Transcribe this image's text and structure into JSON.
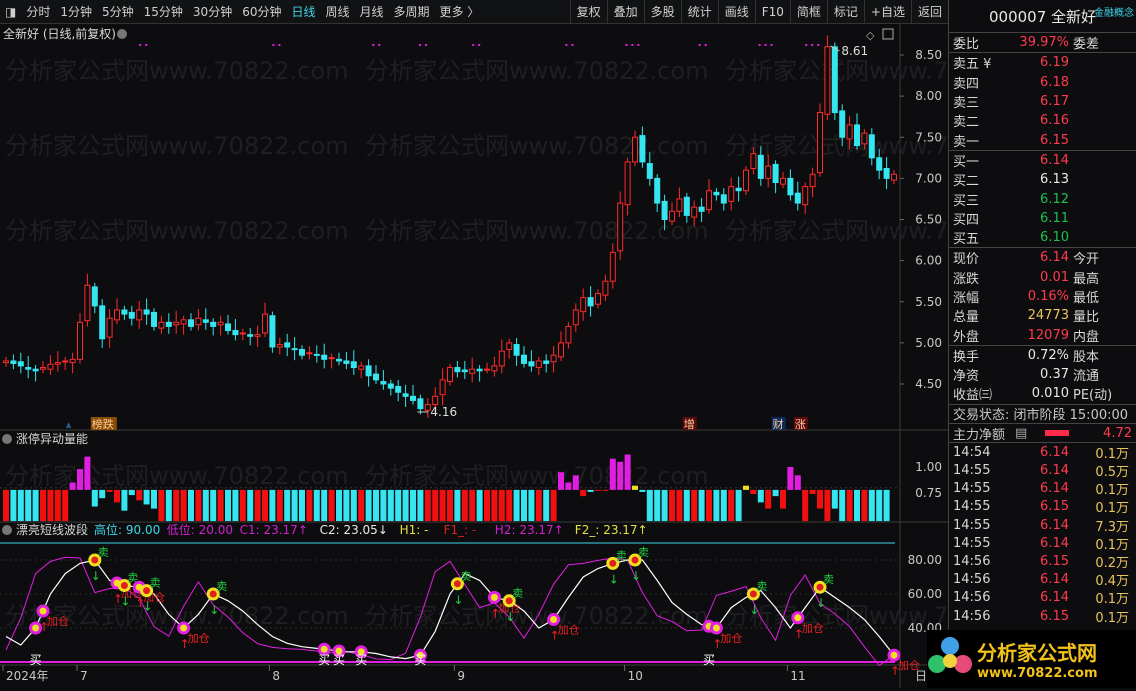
{
  "toolbar": {
    "periods": [
      "分时",
      "1分钟",
      "5分钟",
      "15分钟",
      "30分钟",
      "60分钟",
      "日线",
      "周线",
      "月线",
      "多周期",
      "更多 〉"
    ],
    "active": "日线",
    "actions": [
      "复权",
      "叠加",
      "多股",
      "统计",
      "画线",
      "F10",
      "简框",
      "标记",
      "+自选",
      "返回"
    ]
  },
  "chart": {
    "title": "全新好 (日线,前复权)",
    "price_axis": [
      "8.50",
      "8.00",
      "7.50",
      "7.00",
      "6.50",
      "6.00",
      "5.50",
      "5.00",
      "4.50"
    ],
    "high_label": "8.61",
    "low_label": "4.16",
    "events": [
      {
        "i": 12,
        "text": "榜跌",
        "color": "#8a4a00"
      },
      {
        "i": 92,
        "text": "增",
        "color": "#5a0a0a"
      },
      {
        "i": 104,
        "text": "财",
        "color": "#0a2a5a"
      },
      {
        "i": 107,
        "text": "涨",
        "color": "#5a0a0a"
      }
    ],
    "closes": [
      4.78,
      4.75,
      4.72,
      4.68,
      4.66,
      4.7,
      4.74,
      4.76,
      4.78,
      4.8,
      5.25,
      5.7,
      5.45,
      5.05,
      5.3,
      5.4,
      5.35,
      5.3,
      5.4,
      5.35,
      5.2,
      5.25,
      5.2,
      5.25,
      5.28,
      5.2,
      5.3,
      5.25,
      5.2,
      5.25,
      5.15,
      5.1,
      5.12,
      5.08,
      5.1,
      5.35,
      4.95,
      4.98,
      4.95,
      4.92,
      4.85,
      4.88,
      4.85,
      4.8,
      4.82,
      4.78,
      4.75,
      4.7,
      4.72,
      4.6,
      4.55,
      4.5,
      4.45,
      4.4,
      4.35,
      4.3,
      4.2,
      4.25,
      4.35,
      4.55,
      4.7,
      4.65,
      4.65,
      4.68,
      4.66,
      4.68,
      4.72,
      4.9,
      5.0,
      4.85,
      4.75,
      4.72,
      4.78,
      4.75,
      4.85,
      5.0,
      5.2,
      5.4,
      5.55,
      5.45,
      5.6,
      5.75,
      6.1,
      6.7,
      7.2,
      7.5,
      7.2,
      7.0,
      6.7,
      6.5,
      6.6,
      6.75,
      6.55,
      6.65,
      6.6,
      6.85,
      6.8,
      6.7,
      6.9,
      6.85,
      7.1,
      7.3,
      7.0,
      7.15,
      6.95,
      7.0,
      6.8,
      6.7,
      6.9,
      7.05,
      7.8,
      8.6,
      7.8,
      7.5,
      7.65,
      7.4,
      7.55,
      7.25,
      7.1,
      7.0,
      7.05
    ]
  },
  "volume_indicator": {
    "title": "涨停异动量能",
    "axis": [
      "1.00",
      "0.75"
    ],
    "values": [
      0.48,
      0.48,
      0.48,
      0.48,
      0.48,
      0.48,
      0.48,
      0.48,
      0.48,
      0.85,
      0.98,
      1.1,
      0.62,
      0.7,
      0.76,
      0.66,
      0.58,
      0.73,
      0.68,
      0.64,
      0.6,
      0.48,
      0.48,
      0.48,
      0.48,
      0.48,
      0.48,
      0.48,
      0.48,
      0.48,
      0.48,
      0.48,
      0.48,
      0.48,
      0.48,
      0.48,
      0.48,
      0.48,
      0.48,
      0.48,
      0.48,
      0.48,
      0.48,
      0.48,
      0.48,
      0.48,
      0.48,
      0.48,
      0.48,
      0.48,
      0.48,
      0.48,
      0.48,
      0.48,
      0.48,
      0.48,
      0.48,
      0.48,
      0.48,
      0.48,
      0.48,
      0.48,
      0.48,
      0.48,
      0.48,
      0.48,
      0.48,
      0.48,
      0.48,
      0.48,
      0.48,
      0.48,
      0.48,
      0.48,
      0.48,
      0.95,
      0.85,
      0.92,
      0.72,
      0.76,
      0.8,
      0.78,
      1.08,
      1.05,
      1.12,
      0.82,
      0.76,
      0.48,
      0.48,
      0.48,
      0.48,
      0.48,
      0.48,
      0.48,
      0.48,
      0.48,
      0.48,
      0.48,
      0.48,
      0.48,
      0.82,
      0.74,
      0.66,
      0.6,
      0.72,
      0.6,
      1.0,
      0.92,
      0.48,
      0.74,
      0.6,
      0.48,
      0.6,
      0.48,
      0.48,
      0.48,
      0.48,
      0.48,
      0.48,
      0.48
    ]
  },
  "wave_indicator": {
    "title": "漂亮短线波段",
    "params": [
      {
        "text": "高位: 90.00",
        "color": "#3fd6e8"
      },
      {
        "text": "低位: 20.00",
        "color": "#d21fd2"
      },
      {
        "text": "C1: 23.17↑",
        "color": "#d21fd2"
      },
      {
        "text": "C2: 23.05↓",
        "color": "#e8e8e8"
      },
      {
        "text": "H1: -",
        "color": "#e8e040"
      },
      {
        "text": "F1_: -",
        "color": "#e02020"
      },
      {
        "text": "H2: 23.17↑",
        "color": "#d21fd2"
      },
      {
        "text": "F2_: 23.17↑",
        "color": "#e8e040"
      }
    ],
    "axis": [
      "80.00",
      "60.00",
      "40.00"
    ],
    "high": 90,
    "low": 20,
    "line": [
      35,
      30,
      40,
      60,
      72,
      78,
      80,
      68,
      65,
      64,
      60,
      48,
      40,
      48,
      60,
      56,
      50,
      42,
      35,
      31,
      29,
      28,
      27,
      26,
      26,
      25,
      23,
      22,
      24,
      38,
      60,
      72,
      68,
      58,
      56,
      50,
      40,
      45,
      58,
      70,
      75,
      78,
      80,
      80,
      68,
      55,
      48,
      42,
      40,
      52,
      58,
      62,
      52,
      40,
      52,
      64,
      58,
      52,
      45,
      35,
      24
    ],
    "signals": [
      {
        "i": 4,
        "t": "买"
      },
      {
        "i": 5,
        "t": "加仓"
      },
      {
        "i": 12,
        "t": "卖"
      },
      {
        "i": 15,
        "t": "加仓"
      },
      {
        "i": 16,
        "t": "卖"
      },
      {
        "i": 18,
        "t": "加仓"
      },
      {
        "i": 19,
        "t": "卖"
      },
      {
        "i": 24,
        "t": "加仓"
      },
      {
        "i": 28,
        "t": "卖"
      },
      {
        "i": 43,
        "t": "买"
      },
      {
        "i": 45,
        "t": "买"
      },
      {
        "i": 48,
        "t": "买"
      },
      {
        "i": 56,
        "t": "买"
      },
      {
        "i": 61,
        "t": "卖"
      },
      {
        "i": 66,
        "t": "加仓"
      },
      {
        "i": 68,
        "t": "卖"
      },
      {
        "i": 74,
        "t": "加仓"
      },
      {
        "i": 82,
        "t": "卖"
      },
      {
        "i": 85,
        "t": "卖"
      },
      {
        "i": 95,
        "t": "买"
      },
      {
        "i": 96,
        "t": "加仓"
      },
      {
        "i": 101,
        "t": "卖"
      },
      {
        "i": 107,
        "t": "加仓"
      },
      {
        "i": 110,
        "t": "卖"
      },
      {
        "i": 120,
        "t": "加仓"
      }
    ]
  },
  "time_axis": [
    {
      "x": "2024年",
      "i": 0
    },
    {
      "x": "7",
      "i": 10
    },
    {
      "x": "8",
      "i": 36
    },
    {
      "x": "9",
      "i": 61
    },
    {
      "x": "10",
      "i": 84
    },
    {
      "x": "11",
      "i": 106
    }
  ],
  "time_axis_end": "日",
  "quote": {
    "code_name": "000007 全新好",
    "concept_tag": "金融概念",
    "weibi_label": "委比",
    "weibi": "39.97%",
    "weicha_label": "委差",
    "asks": [
      {
        "l": "卖五 ¥",
        "v": "6.19"
      },
      {
        "l": "卖四",
        "v": "6.18"
      },
      {
        "l": "卖三",
        "v": "6.17"
      },
      {
        "l": "卖二",
        "v": "6.16"
      },
      {
        "l": "卖一",
        "v": "6.15"
      }
    ],
    "bids": [
      {
        "l": "买一",
        "v": "6.14",
        "c": "red"
      },
      {
        "l": "买二",
        "v": "6.13",
        "c": "wht"
      },
      {
        "l": "买三",
        "v": "6.12",
        "c": "grn"
      },
      {
        "l": "买四",
        "v": "6.11",
        "c": "grn"
      },
      {
        "l": "买五",
        "v": "6.10",
        "c": "grn"
      }
    ],
    "stats1": [
      {
        "l": "现价",
        "v": "6.14",
        "c": "red",
        "r": "今开"
      },
      {
        "l": "涨跌",
        "v": "0.01",
        "c": "red",
        "r": "最高"
      },
      {
        "l": "涨幅",
        "v": "0.16%",
        "c": "red",
        "r": "最低"
      },
      {
        "l": "总量",
        "v": "24773",
        "c": "yel",
        "r": "量比"
      },
      {
        "l": "外盘",
        "v": "12079",
        "c": "red",
        "r": "内盘"
      }
    ],
    "stats2": [
      {
        "l": "换手",
        "v": "0.72%",
        "c": "wht",
        "r": "股本"
      },
      {
        "l": "净资",
        "v": "0.37",
        "c": "wht",
        "r": "流通"
      },
      {
        "l": "收益㈢",
        "v": "0.010",
        "c": "wht",
        "r": "PE(动)"
      }
    ],
    "status": "交易状态: 闭市阶段 15:00:00",
    "main_flow_label": "主力净额",
    "main_flow": "4.72",
    "ticks": [
      [
        "14:54",
        "6.14",
        "0.1万"
      ],
      [
        "14:55",
        "6.14",
        "0.5万"
      ],
      [
        "14:55",
        "6.14",
        "0.1万"
      ],
      [
        "14:55",
        "6.15",
        "0.1万"
      ],
      [
        "14:55",
        "6.14",
        "7.3万"
      ],
      [
        "14:55",
        "6.14",
        "0.1万"
      ],
      [
        "14:56",
        "6.15",
        "0.2万"
      ],
      [
        "14:56",
        "6.14",
        "0.4万"
      ],
      [
        "14:56",
        "6.14",
        "0.1万"
      ],
      [
        "14:56",
        "6.15",
        "0.1万"
      ]
    ]
  },
  "watermark": {
    "site_text": "分析家公式网",
    "url": "www.70822.com"
  },
  "colors": {
    "up": "#ff2a2a",
    "down": "#35e6f0",
    "magenta": "#e21ee2",
    "bg": "#0d0d0f"
  }
}
